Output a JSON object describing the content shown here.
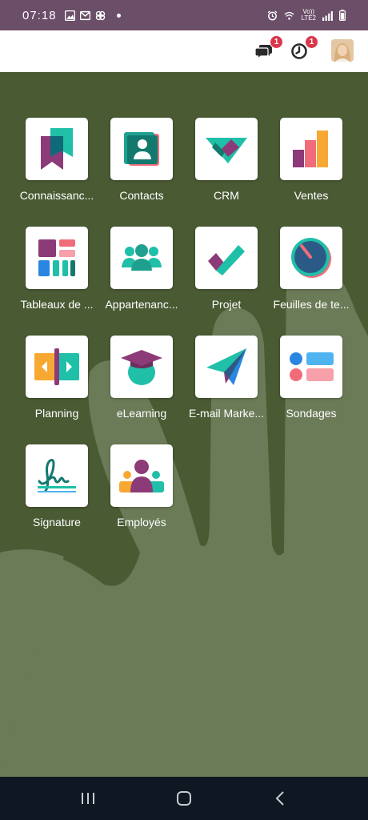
{
  "status_bar": {
    "time": "07:18",
    "network_top": "Vo))",
    "network_bottom": "LTE2"
  },
  "top_bar": {
    "messages_badge": "1",
    "activities_badge": "1"
  },
  "apps": [
    {
      "label": "Connaissanc...",
      "icon": "knowledge-icon"
    },
    {
      "label": "Contacts",
      "icon": "contacts-icon"
    },
    {
      "label": "CRM",
      "icon": "crm-icon"
    },
    {
      "label": "Ventes",
      "icon": "sales-icon"
    },
    {
      "label": "Tableaux de ...",
      "icon": "dashboards-icon"
    },
    {
      "label": "Appartenanc...",
      "icon": "members-icon"
    },
    {
      "label": "Projet",
      "icon": "project-icon"
    },
    {
      "label": "Feuilles de te...",
      "icon": "timesheets-icon"
    },
    {
      "label": "Planning",
      "icon": "planning-icon"
    },
    {
      "label": "eLearning",
      "icon": "elearning-icon"
    },
    {
      "label": "E-mail Marke...",
      "icon": "email-marketing-icon"
    },
    {
      "label": "Sondages",
      "icon": "surveys-icon"
    },
    {
      "label": "Signature",
      "icon": "signature-icon"
    },
    {
      "label": "Employés",
      "icon": "employees-icon"
    }
  ],
  "colors": {
    "status_bar": "#6b4e68",
    "background": "#4a5a33",
    "background_shape": "#6b7a57",
    "nav_bar": "#0f1722",
    "badge": "#d9374a"
  }
}
